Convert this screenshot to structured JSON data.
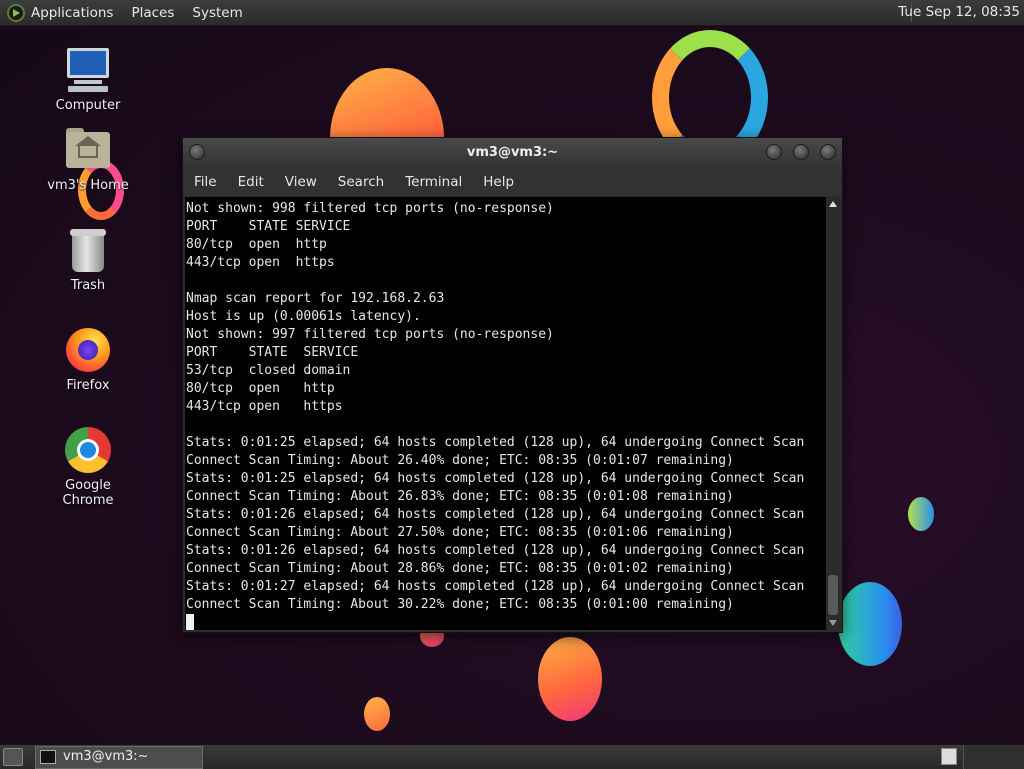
{
  "top_panel": {
    "menus": [
      "Applications",
      "Places",
      "System"
    ],
    "clock": "Tue Sep 12, 08:35"
  },
  "desktop_icons": [
    {
      "label": "Computer",
      "icon": "computer-icon"
    },
    {
      "label": "vm3's Home",
      "icon": "home-folder-icon"
    },
    {
      "label": "Trash",
      "icon": "trash-icon"
    },
    {
      "label": "Firefox",
      "icon": "firefox-icon"
    },
    {
      "label": "Google Chrome",
      "icon": "chrome-icon"
    }
  ],
  "terminal": {
    "title": "vm3@vm3:~",
    "menus": [
      "File",
      "Edit",
      "View",
      "Search",
      "Terminal",
      "Help"
    ],
    "lines": [
      "Not shown: 998 filtered tcp ports (no-response)",
      "PORT    STATE SERVICE",
      "80/tcp  open  http",
      "443/tcp open  https",
      "",
      "Nmap scan report for 192.168.2.63",
      "Host is up (0.00061s latency).",
      "Not shown: 997 filtered tcp ports (no-response)",
      "PORT    STATE  SERVICE",
      "53/tcp  closed domain",
      "80/tcp  open   http",
      "443/tcp open   https",
      "",
      "Stats: 0:01:25 elapsed; 64 hosts completed (128 up), 64 undergoing Connect Scan",
      "Connect Scan Timing: About 26.40% done; ETC: 08:35 (0:01:07 remaining)",
      "Stats: 0:01:25 elapsed; 64 hosts completed (128 up), 64 undergoing Connect Scan",
      "Connect Scan Timing: About 26.83% done; ETC: 08:35 (0:01:08 remaining)",
      "Stats: 0:01:26 elapsed; 64 hosts completed (128 up), 64 undergoing Connect Scan",
      "Connect Scan Timing: About 27.50% done; ETC: 08:35 (0:01:06 remaining)",
      "Stats: 0:01:26 elapsed; 64 hosts completed (128 up), 64 undergoing Connect Scan",
      "Connect Scan Timing: About 28.86% done; ETC: 08:35 (0:01:02 remaining)",
      "Stats: 0:01:27 elapsed; 64 hosts completed (128 up), 64 undergoing Connect Scan",
      "Connect Scan Timing: About 30.22% done; ETC: 08:35 (0:01:00 remaining)"
    ]
  },
  "taskbar": {
    "tasks": [
      {
        "label": "vm3@vm3:~",
        "icon": "terminal-icon"
      }
    ]
  },
  "colors": {
    "panel": "#2b2b2b",
    "terminal_bg": "#000000",
    "terminal_fg": "#e6e6e6",
    "desktop_bg": "#1e0b1f"
  }
}
